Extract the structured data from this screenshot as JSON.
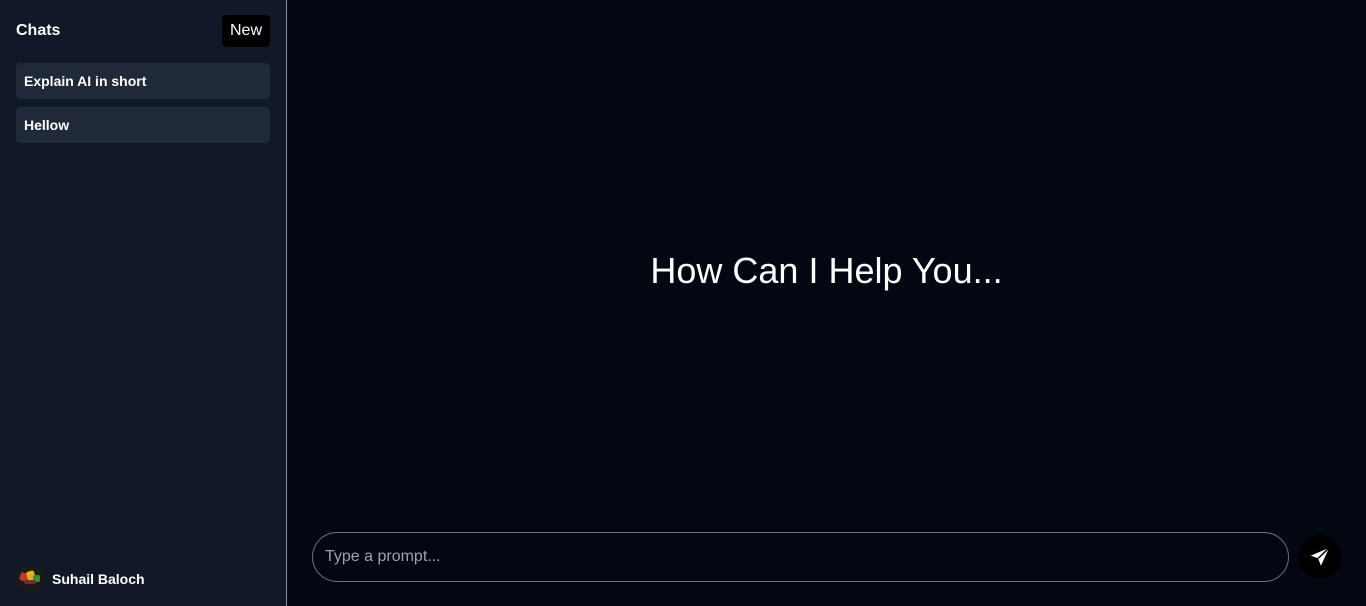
{
  "sidebar": {
    "title": "Chats",
    "new_label": "New",
    "chats": [
      {
        "label": "Explain AI in short"
      },
      {
        "label": "Hellow"
      }
    ],
    "user": {
      "name": "Suhail Baloch",
      "avatar_icon": "user-avatar"
    }
  },
  "main": {
    "heading": "How Can I Help You...",
    "prompt": {
      "value": "",
      "placeholder": "Type a prompt..."
    },
    "send_icon": "paper-plane-icon"
  },
  "colors": {
    "sidebar_bg": "#111827",
    "main_bg": "#030712",
    "chat_item_bg": "#1f2937",
    "button_bg": "#000000",
    "text": "#ffffff",
    "placeholder": "#9ca3af"
  }
}
